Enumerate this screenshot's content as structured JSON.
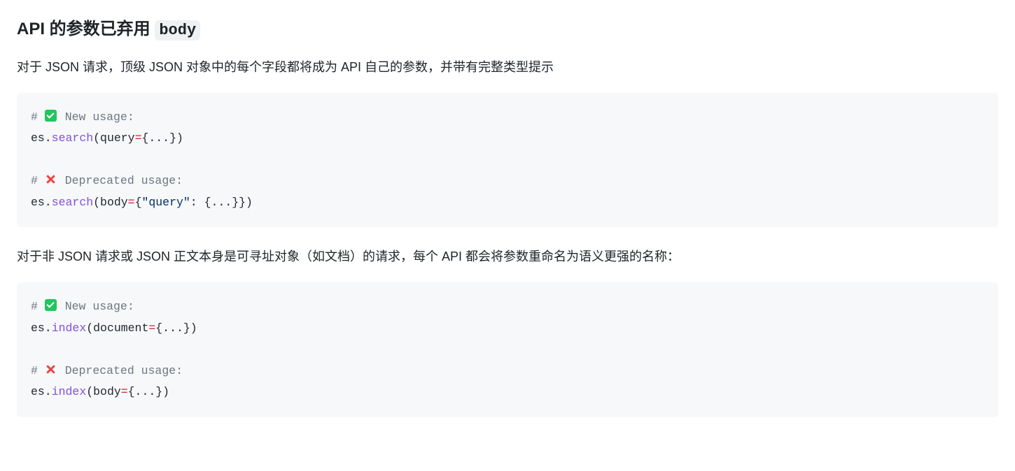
{
  "heading": {
    "prefix": "API 的参数已弃用",
    "code": "body"
  },
  "paragraph1": "对于 JSON 请求，顶级 JSON 对象中的每个字段都将成为 API 自己的参数，并带有完整类型提示",
  "paragraph2": "对于非 JSON 请求或 JSON 正文本身是可寻址对象（如文档）的请求，每个 API 都会将参数重命名为语义更强的名称：",
  "code1": {
    "comment_new_hash": "#",
    "comment_new_text": " New usage:",
    "line_new_prefix": "es.",
    "line_new_func": "search",
    "line_new_open": "(",
    "line_new_param": "query",
    "line_new_eq": "=",
    "line_new_val": "{...}",
    "line_new_close": ")",
    "comment_dep_hash": "#",
    "comment_dep_text": " Deprecated usage:",
    "line_dep_prefix": "es.",
    "line_dep_func": "search",
    "line_dep_open": "(",
    "line_dep_param": "body",
    "line_dep_eq": "=",
    "line_dep_brace_open": "{",
    "line_dep_str": "\"query\"",
    "line_dep_colon": ": ",
    "line_dep_inner": "{...}",
    "line_dep_brace_close": "}",
    "line_dep_close": ")"
  },
  "code2": {
    "comment_new_hash": "#",
    "comment_new_text": " New usage:",
    "line_new_prefix": "es.",
    "line_new_func": "index",
    "line_new_open": "(",
    "line_new_param": "document",
    "line_new_eq": "=",
    "line_new_val": "{...}",
    "line_new_close": ")",
    "comment_dep_hash": "#",
    "comment_dep_text": " Deprecated usage:",
    "line_dep_prefix": "es.",
    "line_dep_func": "index",
    "line_dep_open": "(",
    "line_dep_param": "body",
    "line_dep_eq": "=",
    "line_dep_val": "{...}",
    "line_dep_close": ")"
  }
}
